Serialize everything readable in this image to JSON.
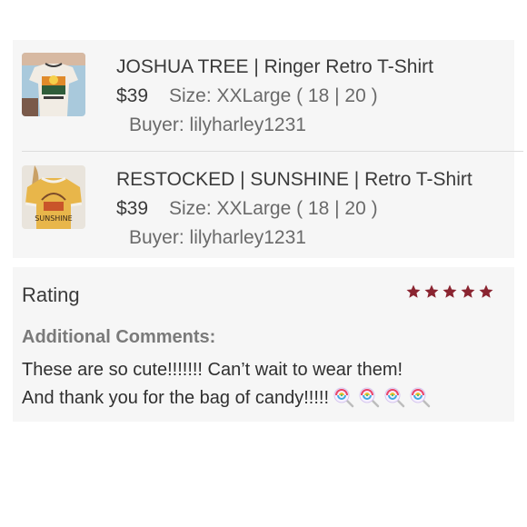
{
  "items": [
    {
      "title": "JOSHUA TREE | Ringer Retro T-Shirt",
      "price": "$39",
      "size": "Size: XXLarge ( 18 | 20 )",
      "buyer": "Buyer: lilyharley1231",
      "thumb_icon": "white-ringer-tshirt-photo"
    },
    {
      "title": "RESTOCKED | SUNSHINE | Retro T-Shirt",
      "price": "$39",
      "size": "Size: XXLarge ( 18 | 20 )",
      "buyer": "Buyer: lilyharley1231",
      "thumb_icon": "yellow-sunshine-tshirt-photo",
      "thumb_text": "SUNSHINE"
    }
  ],
  "rating": {
    "label": "Rating",
    "stars": 5,
    "max_stars": 5,
    "star_color": "#8a2430"
  },
  "comments": {
    "heading": "Additional Comments:",
    "line1": "These are so cute!!!!!!! Can’t wait to wear them!",
    "line2": "And thank you for the bag of candy!!!!!",
    "emoji_icon": "lollipop-icon",
    "emoji_count": 4
  }
}
